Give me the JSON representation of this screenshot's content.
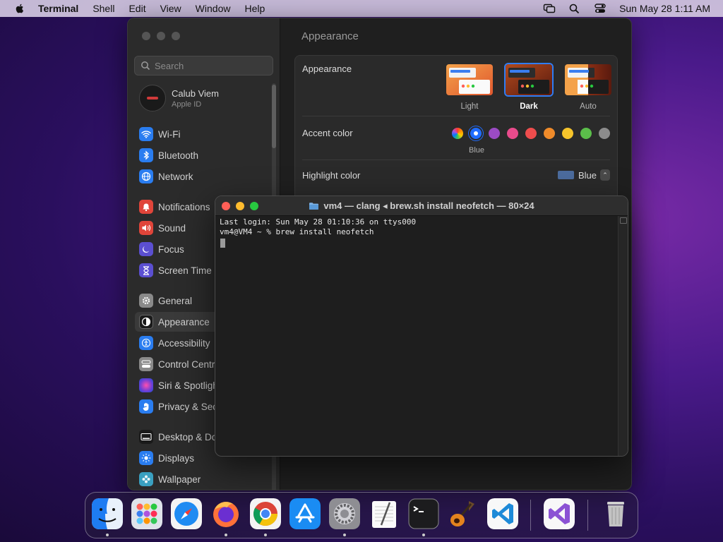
{
  "menubar": {
    "app": "Terminal",
    "items": [
      "Shell",
      "Edit",
      "View",
      "Window",
      "Help"
    ],
    "clock": "Sun May 28  1:11 AM"
  },
  "settings": {
    "search_placeholder": "Search",
    "account": {
      "name": "Calub Viem",
      "subtitle": "Apple ID"
    },
    "sidebar": [
      {
        "label": "Wi-Fi",
        "icon": "wifi-icon",
        "color": "#2a7df0"
      },
      {
        "label": "Bluetooth",
        "icon": "bluetooth-icon",
        "color": "#2a7df0"
      },
      {
        "label": "Network",
        "icon": "globe-icon",
        "color": "#2a7df0"
      },
      {
        "label": "Notifications",
        "icon": "bell-icon",
        "color": "#e0453a"
      },
      {
        "label": "Sound",
        "icon": "speaker-icon",
        "color": "#e0453a"
      },
      {
        "label": "Focus",
        "icon": "moon-icon",
        "color": "#5b4fd1"
      },
      {
        "label": "Screen Time",
        "icon": "hourglass-icon",
        "color": "#5b4fd1"
      },
      {
        "label": "General",
        "icon": "gear-icon",
        "color": "#8a8a8a"
      },
      {
        "label": "Appearance",
        "icon": "appearance-icon",
        "color": "#1a1a1a"
      },
      {
        "label": "Accessibility",
        "icon": "accessibility-icon",
        "color": "#2a7df0"
      },
      {
        "label": "Control Centre",
        "icon": "control-centre-icon",
        "color": "#8a8a8a"
      },
      {
        "label": "Siri & Spotlight",
        "icon": "siri-icon",
        "color": "#6b3fd8"
      },
      {
        "label": "Privacy & Security",
        "icon": "hand-icon",
        "color": "#2a7df0"
      },
      {
        "label": "Desktop & Dock",
        "icon": "desktop-icon",
        "color": "#1a1a1a"
      },
      {
        "label": "Displays",
        "icon": "sun-icon",
        "color": "#2a7df0"
      },
      {
        "label": "Wallpaper",
        "icon": "wallpaper-icon",
        "color": "#3aa0c0"
      }
    ],
    "main_title": "Appearance",
    "appearance_label": "Appearance",
    "appearance_options": [
      "Light",
      "Dark",
      "Auto"
    ],
    "appearance_selected": "Dark",
    "accent_label": "Accent color",
    "accent_colors": [
      "multicolor",
      "#1f6cff",
      "#9b4bc4",
      "#e94b8c",
      "#ee4d4d",
      "#f08b2a",
      "#f6c42b",
      "#5bbe4a",
      "#8c8c8c"
    ],
    "accent_selected_name": "Blue",
    "highlight_label": "Highlight color",
    "highlight_value": "Blue",
    "highlight_color": "#4c6c9e"
  },
  "terminal": {
    "title": "vm4 — clang ◂ brew.sh install neofetch — 80×24",
    "lines": [
      "Last login: Sun May 28 01:10:36 on ttys000",
      "vm4@VM4 ~ % brew install neofetch"
    ]
  },
  "dock": [
    {
      "name": "finder",
      "running": true
    },
    {
      "name": "launchpad",
      "running": false
    },
    {
      "name": "safari",
      "running": false
    },
    {
      "name": "firefox",
      "running": true
    },
    {
      "name": "chrome",
      "running": true
    },
    {
      "name": "app-store",
      "running": false
    },
    {
      "name": "system-settings",
      "running": true
    },
    {
      "name": "textedit",
      "running": false
    },
    {
      "name": "terminal",
      "running": true
    },
    {
      "name": "garageband",
      "running": false
    },
    {
      "name": "vscode",
      "running": false
    },
    {
      "name": "visual-studio",
      "running": false
    },
    {
      "name": "trash",
      "running": false
    }
  ]
}
